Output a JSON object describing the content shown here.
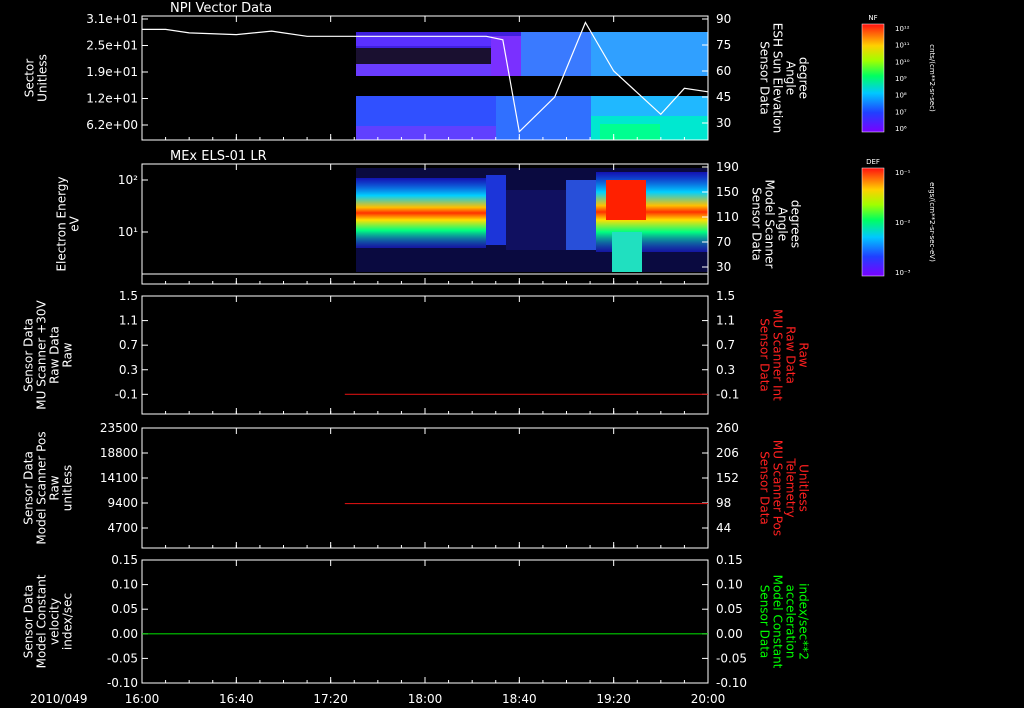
{
  "colors": {
    "background": "#000000",
    "axis": "#ffffff",
    "red_series": "#d01010",
    "green_series": "#00cc00",
    "green_label": "#00ff00",
    "red_label": "#ff2020"
  },
  "time_axis": {
    "date_label": "2010/049",
    "ticks": [
      "16:00",
      "16:40",
      "17:20",
      "18:00",
      "18:40",
      "19:20",
      "20:00"
    ]
  },
  "chart_data": [
    {
      "type": "heatmap",
      "title": "NPI Vector Data",
      "ylabel": [
        "Sector",
        "Unitless"
      ],
      "y_ticks": [
        "3.1e+01",
        "2.5e+01",
        "1.9e+01",
        "1.2e+01",
        "6.2e+00"
      ],
      "right_label": [
        "Sensor Data",
        "ESH Sun Elevation",
        "Angle",
        "degree"
      ],
      "right_ticks": [
        "90",
        "75",
        "60",
        "45",
        "30"
      ],
      "data_start": "17:26",
      "overlay_line": {
        "name": "ESH Sun Elevation Angle",
        "x": [
          "16:00",
          "16:10",
          "16:20",
          "16:40",
          "16:55",
          "17:00",
          "17:10",
          "17:20",
          "18:10",
          "18:26",
          "18:33",
          "18:40",
          "18:55",
          "19:08",
          "19:20",
          "19:40",
          "19:50",
          "20:00"
        ],
        "y": [
          84,
          84,
          82,
          81,
          83,
          82,
          80,
          80,
          80,
          80,
          78,
          25,
          45,
          88,
          60,
          35,
          50,
          48
        ]
      },
      "colorbar": {
        "label": "NF",
        "units": "cnts/(cm**2-sr-sec)",
        "ticks": [
          "10¹²",
          "10¹¹",
          "10¹⁰",
          "10⁹",
          "10⁸",
          "10⁷",
          "10⁶"
        ]
      }
    },
    {
      "type": "heatmap",
      "title": "MEx ELS-01 LR",
      "ylabel": [
        "Electron Energy",
        "eV"
      ],
      "y_ticks": [
        "10²",
        "10¹"
      ],
      "right_label": [
        "Sensor Data",
        "Model Scanner",
        "Angle",
        "degrees"
      ],
      "right_ticks": [
        "190",
        "150",
        "110",
        "70",
        "30"
      ],
      "data_start": "17:26",
      "colorbar": {
        "label": "DEF",
        "units": "ergs/(cm**2-sr-sec-eV)",
        "ticks": [
          "10⁻¹",
          "10⁻²",
          "10⁻³"
        ]
      }
    },
    {
      "type": "line",
      "ylabel": [
        "Sensor Data",
        "MU Scanner +30V",
        "Raw Data",
        "Raw"
      ],
      "y_ticks": [
        "1.5",
        "1.1",
        "0.7",
        "0.3",
        "-0.1"
      ],
      "ylim": [
        -0.3,
        1.5
      ],
      "right_label": [
        "Sensor Data",
        "MU Scanner Int",
        "Raw Data",
        "Raw"
      ],
      "right_ticks": [
        "1.5",
        "1.1",
        "0.7",
        "0.3",
        "-0.1"
      ],
      "series": [
        {
          "x_start": "17:26",
          "x_end": "20:00",
          "value": 0.0
        }
      ]
    },
    {
      "type": "line",
      "ylabel": [
        "Sensor Data",
        "Model Scanner Pos",
        "Raw",
        "unitless"
      ],
      "y_ticks": [
        "23500",
        "18800",
        "14100",
        "9400",
        "4700"
      ],
      "ylim": [
        0,
        23500
      ],
      "right_label": [
        "Sensor Data",
        "MU Scanner Pos",
        "Telemetry",
        "Unitless"
      ],
      "right_ticks": [
        "260",
        "206",
        "152",
        "98",
        "44"
      ],
      "series": [
        {
          "x_start": "17:26",
          "x_end": "20:00",
          "value": 8700
        }
      ]
    },
    {
      "type": "line",
      "ylabel": [
        "Sensor Data",
        "Model Constant",
        "velocity",
        "index/sec"
      ],
      "y_ticks": [
        "0.15",
        "0.10",
        "0.05",
        "0.00",
        "-0.05",
        "-0.10"
      ],
      "ylim": [
        -0.1,
        0.15
      ],
      "right_label": [
        "Sensor Data",
        "Model Constant",
        "acceleration",
        "index/sec**2"
      ],
      "right_ticks": [
        "0.15",
        "0.10",
        "0.05",
        "0.00",
        "-0.05",
        "-0.10"
      ],
      "series": [
        {
          "x_start": "16:00",
          "x_end": "20:00",
          "value": 0.0
        }
      ]
    }
  ]
}
